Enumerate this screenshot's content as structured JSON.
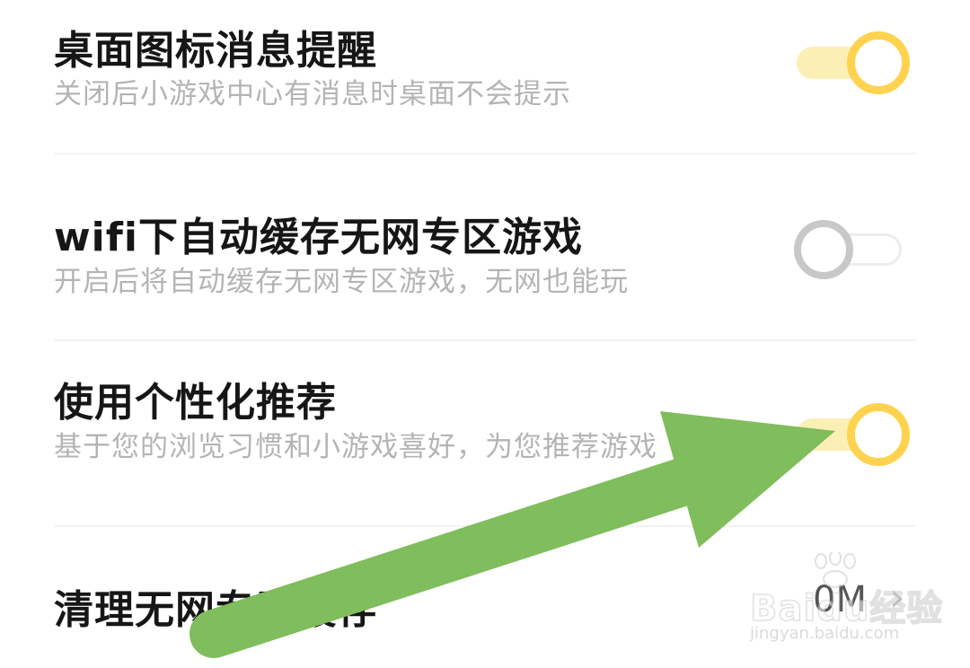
{
  "settings": {
    "items": [
      {
        "title": "桌面图标消息提醒",
        "subtitle": "关闭后小游戏中心有消息时桌面不会提示",
        "toggle_state": "on"
      },
      {
        "title": "wifi下自动缓存无网专区游戏",
        "subtitle": "开启后将自动缓存无网专区游戏，无网也能玩",
        "toggle_state": "off"
      },
      {
        "title": "使用个性化推荐",
        "subtitle": "基于您的浏览习惯和小游戏喜好，为您推荐游戏",
        "toggle_state": "on"
      },
      {
        "title": "清理无网专区缓存",
        "value": "0M"
      }
    ]
  },
  "colors": {
    "toggle_on_knob": "#ffd24f",
    "toggle_on_track": "#fcefb6",
    "toggle_off": "#c8c8c8",
    "annotation_arrow": "#80bd5c"
  },
  "watermark": {
    "brand": "Baidu经验",
    "url": "jingyan.baidu.com"
  }
}
